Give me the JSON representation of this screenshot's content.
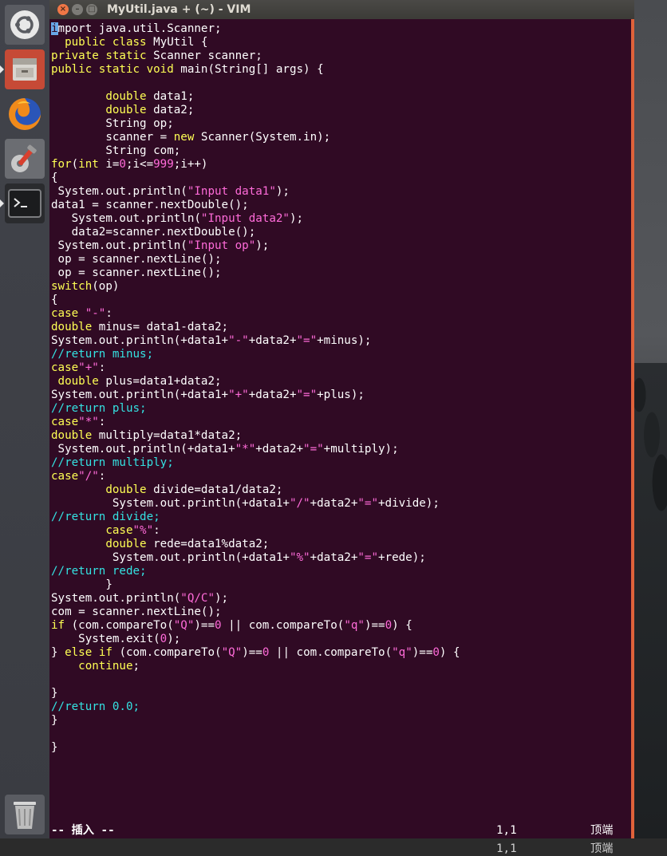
{
  "window": {
    "title": "MyUtil.java + (~) - VIM",
    "close_glyph": "×",
    "min_glyph": "–",
    "max_glyph": "□"
  },
  "launcher": {
    "items": [
      {
        "name": "ubuntu-dash-icon"
      },
      {
        "name": "files-icon"
      },
      {
        "name": "firefox-icon"
      },
      {
        "name": "system-settings-icon"
      },
      {
        "name": "terminal-icon"
      },
      {
        "name": "trash-icon"
      }
    ]
  },
  "code": {
    "lines": [
      [
        [
          "cursor",
          "i"
        ],
        [
          "",
          "mport java.util.Scanner;"
        ]
      ],
      [
        [
          "",
          "  "
        ],
        [
          "kw",
          "public"
        ],
        [
          "",
          " "
        ],
        [
          "kw",
          "class"
        ],
        [
          "",
          " MyUtil {"
        ]
      ],
      [
        [
          "kw",
          "private"
        ],
        [
          "",
          " "
        ],
        [
          "kw",
          "static"
        ],
        [
          "",
          " Scanner scanner;"
        ]
      ],
      [
        [
          "kw",
          "public"
        ],
        [
          "",
          " "
        ],
        [
          "kw",
          "static"
        ],
        [
          "",
          " "
        ],
        [
          "kw",
          "void"
        ],
        [
          "",
          " main(String[] args) {"
        ]
      ],
      [
        [
          "",
          ""
        ]
      ],
      [
        [
          "",
          "        "
        ],
        [
          "kw",
          "double"
        ],
        [
          "",
          " data1;"
        ]
      ],
      [
        [
          "",
          "        "
        ],
        [
          "kw",
          "double"
        ],
        [
          "",
          " data2;"
        ]
      ],
      [
        [
          "",
          "        String op;"
        ]
      ],
      [
        [
          "",
          "        scanner = "
        ],
        [
          "kw",
          "new"
        ],
        [
          "",
          " Scanner(System.in);"
        ]
      ],
      [
        [
          "",
          "        String com;"
        ]
      ],
      [
        [
          "kw",
          "for"
        ],
        [
          "",
          "("
        ],
        [
          "kw",
          "int"
        ],
        [
          "",
          " i="
        ],
        [
          "num",
          "0"
        ],
        [
          "",
          ";i<="
        ],
        [
          "num",
          "999"
        ],
        [
          "",
          ";i++)"
        ]
      ],
      [
        [
          "",
          "{"
        ]
      ],
      [
        [
          "",
          " System.out.println("
        ],
        [
          "str",
          "\"Input data1\""
        ],
        [
          "",
          ");"
        ]
      ],
      [
        [
          "",
          "data1 = scanner.nextDouble();"
        ]
      ],
      [
        [
          "",
          "   System.out.println("
        ],
        [
          "str",
          "\"Input data2\""
        ],
        [
          "",
          ");"
        ]
      ],
      [
        [
          "",
          "   data2=scanner.nextDouble();"
        ]
      ],
      [
        [
          "",
          " System.out.println("
        ],
        [
          "str",
          "\"Input op\""
        ],
        [
          "",
          ");"
        ]
      ],
      [
        [
          "",
          " op = scanner.nextLine();"
        ]
      ],
      [
        [
          "",
          " op = scanner.nextLine();"
        ]
      ],
      [
        [
          "kw",
          "switch"
        ],
        [
          "",
          "(op)"
        ]
      ],
      [
        [
          "",
          "{"
        ]
      ],
      [
        [
          "kw",
          "case"
        ],
        [
          "",
          " "
        ],
        [
          "str",
          "\"-\""
        ],
        [
          "",
          ":"
        ]
      ],
      [
        [
          "kw",
          "double"
        ],
        [
          "",
          " minus= data1-data2;"
        ]
      ],
      [
        [
          "",
          "System.out.println(+data1+"
        ],
        [
          "str",
          "\"-\""
        ],
        [
          "",
          "+data2+"
        ],
        [
          "str",
          "\"=\""
        ],
        [
          "",
          "+minus);"
        ]
      ],
      [
        [
          "cm",
          "//return minus;"
        ]
      ],
      [
        [
          "kw",
          "case"
        ],
        [
          "str",
          "\"+\""
        ],
        [
          "",
          ":"
        ]
      ],
      [
        [
          "",
          " "
        ],
        [
          "kw",
          "double"
        ],
        [
          "",
          " plus=data1+data2;"
        ]
      ],
      [
        [
          "",
          "System.out.println(+data1+"
        ],
        [
          "str",
          "\"+\""
        ],
        [
          "",
          "+data2+"
        ],
        [
          "str",
          "\"=\""
        ],
        [
          "",
          "+plus);"
        ]
      ],
      [
        [
          "cm",
          "//return plus;"
        ]
      ],
      [
        [
          "kw",
          "case"
        ],
        [
          "str",
          "\"*\""
        ],
        [
          "",
          ":"
        ]
      ],
      [
        [
          "kw",
          "double"
        ],
        [
          "",
          " multiply=data1*data2;"
        ]
      ],
      [
        [
          "",
          " System.out.println(+data1+"
        ],
        [
          "str",
          "\"*\""
        ],
        [
          "",
          "+data2+"
        ],
        [
          "str",
          "\"=\""
        ],
        [
          "",
          "+multiply);"
        ]
      ],
      [
        [
          "cm",
          "//return multiply;"
        ]
      ],
      [
        [
          "kw",
          "case"
        ],
        [
          "str",
          "\"/\""
        ],
        [
          "",
          ":"
        ]
      ],
      [
        [
          "",
          "        "
        ],
        [
          "kw",
          "double"
        ],
        [
          "",
          " divide=data1/data2;"
        ]
      ],
      [
        [
          "",
          "         System.out.println(+data1+"
        ],
        [
          "str",
          "\"/\""
        ],
        [
          "",
          "+data2+"
        ],
        [
          "str",
          "\"=\""
        ],
        [
          "",
          "+divide);"
        ]
      ],
      [
        [
          "cm",
          "//return divide;"
        ]
      ],
      [
        [
          "",
          "        "
        ],
        [
          "kw",
          "case"
        ],
        [
          "str",
          "\"%\""
        ],
        [
          "",
          ":"
        ]
      ],
      [
        [
          "",
          "        "
        ],
        [
          "kw",
          "double"
        ],
        [
          "",
          " rede=data1%data2;"
        ]
      ],
      [
        [
          "",
          "         System.out.println(+data1+"
        ],
        [
          "str",
          "\"%\""
        ],
        [
          "",
          "+data2+"
        ],
        [
          "str",
          "\"=\""
        ],
        [
          "",
          "+rede);"
        ]
      ],
      [
        [
          "cm",
          "//return rede;"
        ]
      ],
      [
        [
          "",
          "        }"
        ]
      ],
      [
        [
          "",
          "System.out.println("
        ],
        [
          "str",
          "\"Q/C\""
        ],
        [
          "",
          ");"
        ]
      ],
      [
        [
          "",
          "com = scanner.nextLine();"
        ]
      ],
      [
        [
          "kw",
          "if"
        ],
        [
          "",
          " (com.compareTo("
        ],
        [
          "str",
          "\"Q\""
        ],
        [
          "",
          ")=="
        ],
        [
          "num",
          "0"
        ],
        [
          "",
          " || com.compareTo("
        ],
        [
          "str",
          "\"q\""
        ],
        [
          "",
          ")=="
        ],
        [
          "num",
          "0"
        ],
        [
          "",
          ") {"
        ]
      ],
      [
        [
          "",
          "    System.exit("
        ],
        [
          "num",
          "0"
        ],
        [
          "",
          ");"
        ]
      ],
      [
        [
          "",
          "} "
        ],
        [
          "kw",
          "else"
        ],
        [
          "",
          " "
        ],
        [
          "kw",
          "if"
        ],
        [
          "",
          " (com.compareTo("
        ],
        [
          "str",
          "\"Q\""
        ],
        [
          "",
          ")=="
        ],
        [
          "num",
          "0"
        ],
        [
          "",
          " || com.compareTo("
        ],
        [
          "str",
          "\"q\""
        ],
        [
          "",
          ")=="
        ],
        [
          "num",
          "0"
        ],
        [
          "",
          ") {"
        ]
      ],
      [
        [
          "",
          "    "
        ],
        [
          "kw",
          "continue"
        ],
        [
          "",
          ";"
        ]
      ],
      [
        [
          "",
          ""
        ]
      ],
      [
        [
          "",
          "}"
        ]
      ],
      [
        [
          "cm",
          "//return 0.0;"
        ]
      ],
      [
        [
          "",
          "}"
        ]
      ],
      [
        [
          "",
          ""
        ]
      ],
      [
        [
          "",
          "}"
        ]
      ]
    ]
  },
  "status": {
    "mode": "-- 插入 --",
    "position": "1,1",
    "scroll": "顶端"
  }
}
